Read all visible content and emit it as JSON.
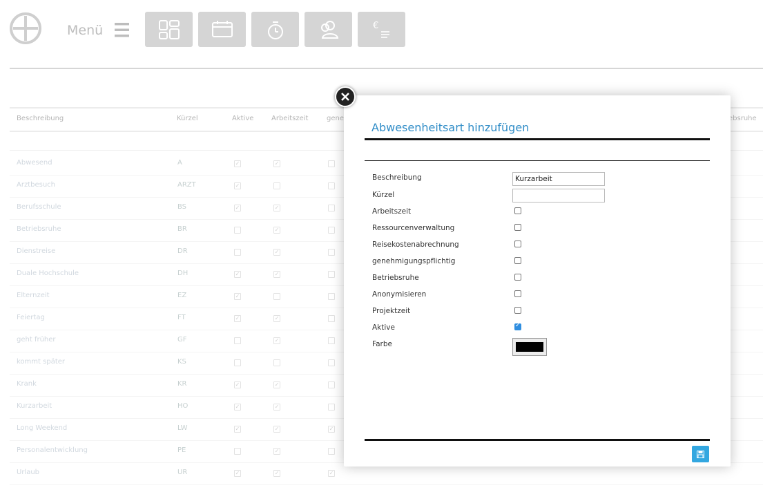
{
  "header": {
    "menu_label": "Menü",
    "toolbar": [
      {
        "name": "dashboard-icon"
      },
      {
        "name": "calendar-icon"
      },
      {
        "name": "stopwatch-icon"
      },
      {
        "name": "users-icon"
      },
      {
        "name": "euro-expenses-icon",
        "glyph": "€"
      }
    ]
  },
  "table": {
    "columns": [
      "Beschreibung",
      "Kürzel",
      "Aktive",
      "Arbeitszeit",
      "gene",
      "ebsruhe"
    ],
    "rows": [
      {
        "desc": "Abwesend",
        "code": "A",
        "aktive": "✓",
        "arbeit": "✓",
        "extra": ""
      },
      {
        "desc": "Arztbesuch",
        "code": "ARZT",
        "aktive": "✓",
        "arbeit": "",
        "extra": ""
      },
      {
        "desc": "Berufsschule",
        "code": "BS",
        "aktive": "✓",
        "arbeit": "✓",
        "extra": ""
      },
      {
        "desc": "Betriebsruhe",
        "code": "BR",
        "aktive": "",
        "arbeit": "✓",
        "extra": ""
      },
      {
        "desc": "Dienstreise",
        "code": "DR",
        "aktive": "",
        "arbeit": "✓",
        "extra": ""
      },
      {
        "desc": "Duale Hochschule",
        "code": "DH",
        "aktive": "✓",
        "arbeit": "✓",
        "extra": ""
      },
      {
        "desc": "Elternzeit",
        "code": "EZ",
        "aktive": "✓",
        "arbeit": "",
        "extra": ""
      },
      {
        "desc": "Feiertag",
        "code": "FT",
        "aktive": "✓",
        "arbeit": "✓",
        "extra": ""
      },
      {
        "desc": "geht früher",
        "code": "GF",
        "aktive": "",
        "arbeit": "✓",
        "extra": ""
      },
      {
        "desc": "kommt später",
        "code": "KS",
        "aktive": "",
        "arbeit": "",
        "extra": ""
      },
      {
        "desc": "Krank",
        "code": "KR",
        "aktive": "✓",
        "arbeit": "✓",
        "extra": ""
      },
      {
        "desc": "Kurzarbeit",
        "code": "HO",
        "aktive": "✓",
        "arbeit": "✓",
        "extra": ""
      },
      {
        "desc": "Long Weekend",
        "code": "LW",
        "aktive": "✓",
        "arbeit": "✓",
        "extra": "✓"
      },
      {
        "desc": "Personalentwicklung",
        "code": "PE",
        "aktive": "",
        "arbeit": "✓",
        "extra": ""
      },
      {
        "desc": "Urlaub",
        "code": "UR",
        "aktive": "✓",
        "arbeit": "✓",
        "extra": "✓"
      }
    ]
  },
  "modal": {
    "title": "Abwesenheitsart hinzufügen",
    "fields": {
      "beschreibung_label": "Beschreibung",
      "beschreibung_value": "Kurzarbeit",
      "kuerzel_label": "Kürzel",
      "kuerzel_value": "",
      "arbeitszeit_label": "Arbeitszeit",
      "ressourcen_label": "Ressourcenverwaltung",
      "reisekosten_label": "Reisekostenabrechnung",
      "genehmigung_label": "genehmigungspflichtig",
      "betriebsruhe_label": "Betriebsruhe",
      "anonym_label": "Anonymisieren",
      "projektzeit_label": "Projektzeit",
      "aktive_label": "Aktive",
      "farbe_label": "Farbe"
    },
    "checkboxes": {
      "arbeitszeit": false,
      "ressourcen": false,
      "reisekosten": false,
      "genehmigung": false,
      "betriebsruhe": false,
      "anonym": false,
      "projektzeit": false,
      "aktive": true
    },
    "farbe_value": "#000000",
    "accent_color": "#2f8cc7"
  }
}
